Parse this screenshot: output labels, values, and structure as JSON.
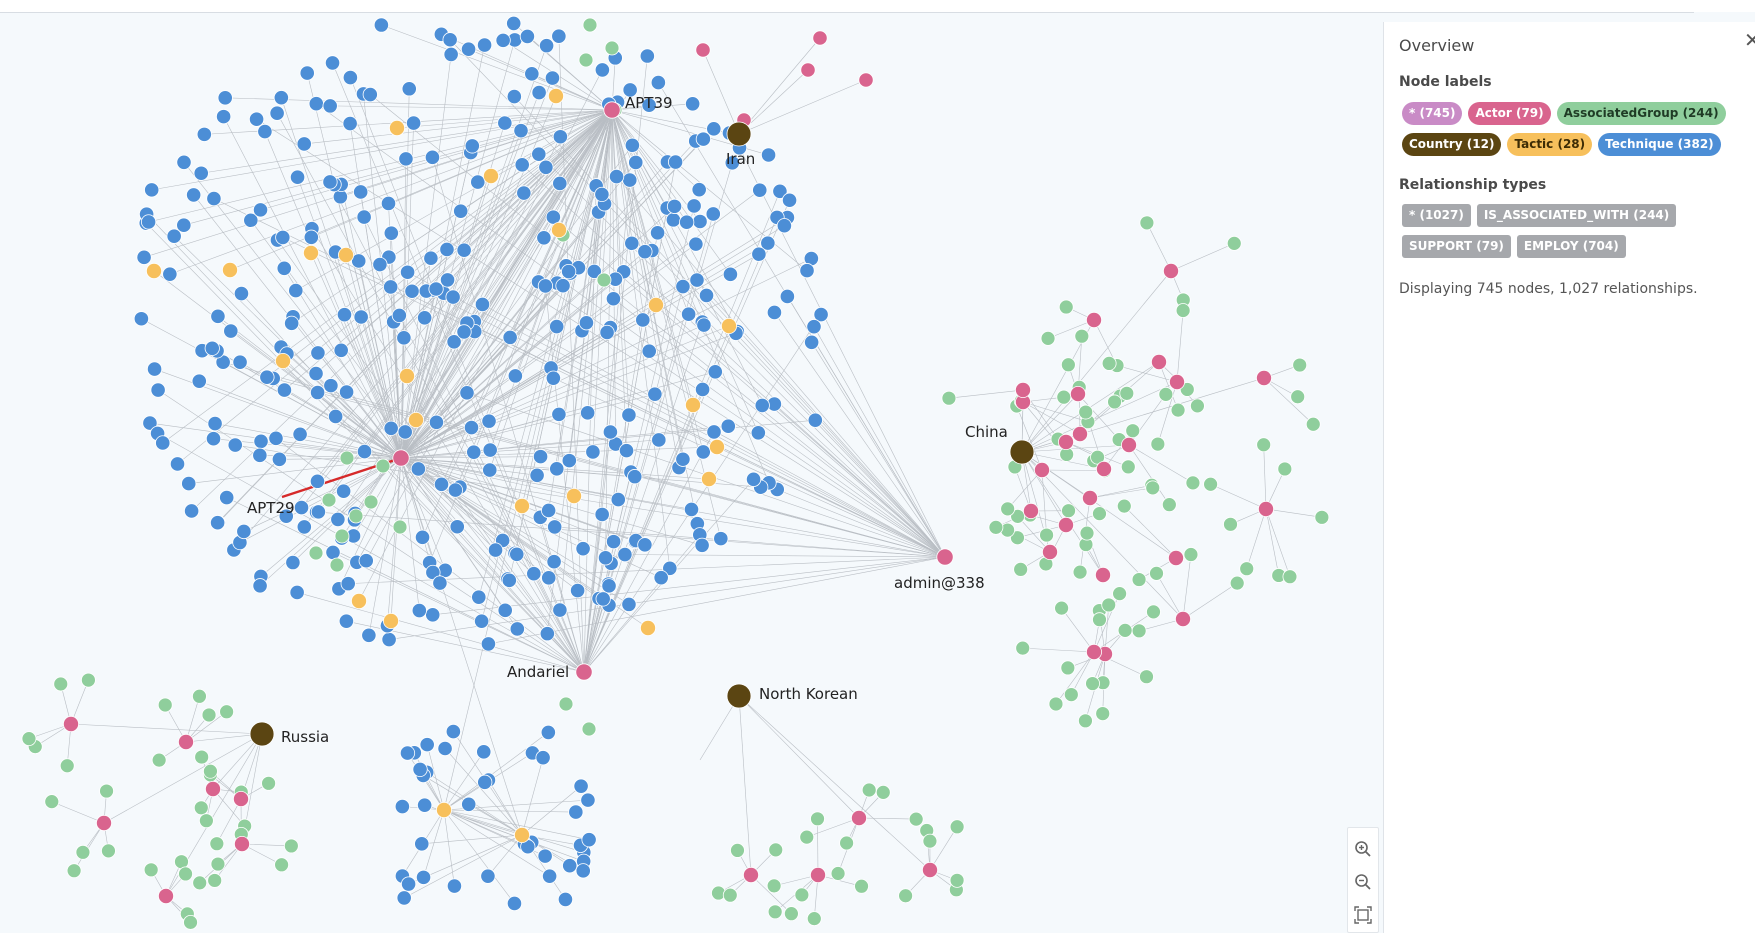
{
  "graph": {
    "hub_labels": {
      "apt39": "APT39",
      "iran": "Iran",
      "apt29": "APT29",
      "china": "China",
      "admin338": "admin@338",
      "andariel": "Andariel",
      "north_korean": "North Korean",
      "russia": "Russia"
    },
    "colors": {
      "technique": "#4c8ed6",
      "tactic": "#f7c05c",
      "actor": "#d9648e",
      "group": "#8fce9c",
      "country": "#5b4512",
      "edge": "#b9bec4",
      "highlight": "#d62a2a"
    }
  },
  "overview": {
    "title": "Overview",
    "node_labels_title": "Node labels",
    "node_labels": [
      {
        "text": "* (745)",
        "bg": "#c98bc6",
        "fg": "#ffffff"
      },
      {
        "text": "Actor (79)",
        "bg": "#d9648e",
        "fg": "#ffffff"
      },
      {
        "text": "AssociatedGroup (244)",
        "bg": "#8fce9c",
        "fg": "#1f3b25"
      },
      {
        "text": "Country (12)",
        "bg": "#5b4512",
        "fg": "#ffffff"
      },
      {
        "text": "Tactic (28)",
        "bg": "#f7c05c",
        "fg": "#3d2c05"
      },
      {
        "text": "Technique (382)",
        "bg": "#4c8ed6",
        "fg": "#ffffff"
      }
    ],
    "relationship_types_title": "Relationship types",
    "relationship_types": [
      {
        "text": "* (1027)"
      },
      {
        "text": "IS_ASSOCIATED_WITH (244)"
      },
      {
        "text": "SUPPORT (79)"
      },
      {
        "text": "EMPLOY (704)"
      }
    ],
    "summary": "Displaying 745 nodes, 1,027 relationships."
  },
  "zoom": {
    "zoom_in_icon": "zoom-in-icon",
    "zoom_out_icon": "zoom-out-icon",
    "fit_icon": "fit-screen-icon"
  }
}
